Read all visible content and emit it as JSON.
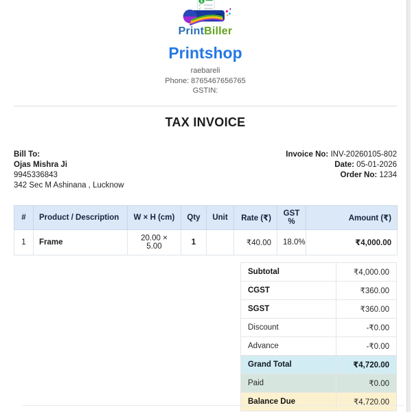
{
  "brand": {
    "logo_print": "Print",
    "logo_biller": "Biller",
    "shop_name": "Printshop",
    "location": "raebareli",
    "phone_line": "Phone: 8765467656765",
    "gstin_line": "GSTIN:"
  },
  "title": "TAX INVOICE",
  "bill_to": {
    "label": "Bill To:",
    "name": "Ojas Mishra Ji",
    "phone": "9945336843",
    "address": "342 Sec M Ashinana , Lucknow"
  },
  "meta": {
    "invoice_no_label": "Invoice No:",
    "invoice_no": "INV-20260105-802",
    "date_label": "Date:",
    "date": "05-01-2026",
    "order_no_label": "Order No:",
    "order_no": "1234"
  },
  "items_table": {
    "headers": [
      "#",
      "Product / Description",
      "W × H (cm)",
      "Qty",
      "Unit",
      "Rate (₹)",
      "GST %",
      "Amount (₹)"
    ],
    "rows": [
      {
        "num": "1",
        "product": "Frame",
        "size": "20.00 × 5.00",
        "qty": "1",
        "unit": "",
        "rate": "₹40.00",
        "gst": "18.0%",
        "amount": "₹4,000.00"
      }
    ]
  },
  "totals": {
    "rows": [
      {
        "label": "Subtotal",
        "value": "₹4,000.00"
      },
      {
        "label": "CGST",
        "value": "₹360.00"
      },
      {
        "label": "SGST",
        "value": "₹360.00"
      },
      {
        "label": "Discount",
        "value": "-₹0.00"
      },
      {
        "label": "Advance",
        "value": "-₹0.00"
      },
      {
        "label": "Grand Total",
        "value": "₹4,720.00"
      },
      {
        "label": "Paid",
        "value": "₹0.00"
      },
      {
        "label": "Balance Due",
        "value": "₹4,720.00"
      }
    ]
  },
  "colors": {
    "shop_name_blue": "#2478e5",
    "logo_print_blue": "#2a6fb5",
    "logo_biller_green": "#62a41c",
    "items_header_bg": "#dbe8f8",
    "grand_total_bg": "#d2ecf3",
    "paid_bg": "#d7e5df",
    "balance_due_bg": "#fcf1cf"
  }
}
